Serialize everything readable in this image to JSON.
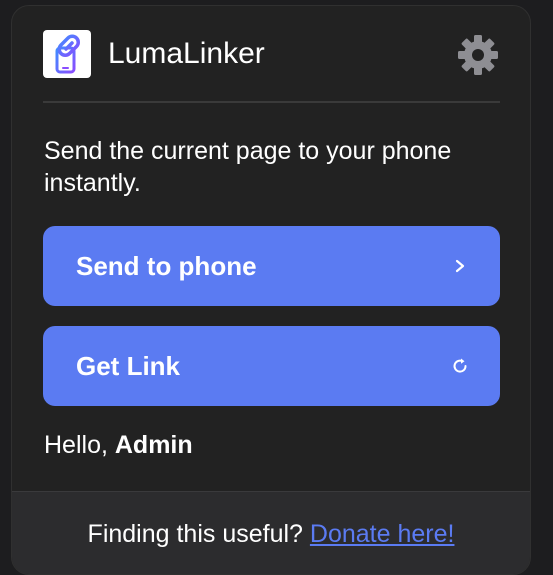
{
  "app": {
    "title": "LumaLinker",
    "logo_icon": "link-phone-icon",
    "settings_icon": "gear-icon"
  },
  "main": {
    "description": "Send the current page to your phone instantly.",
    "buttons": [
      {
        "label": "Send to phone",
        "icon": "chevron-right-icon",
        "glyph": "›"
      },
      {
        "label": "Get Link",
        "icon": "refresh-icon",
        "glyph": "⟳"
      }
    ],
    "greeting": {
      "prefix": "Hello,",
      "user": "Admin"
    }
  },
  "footer": {
    "text": "Finding this useful?",
    "link_label": "Donate here!"
  },
  "colors": {
    "background": "#222222",
    "accent": "#5b7bf2",
    "footer_bg": "#2c2c2e",
    "text": "#ffffff"
  }
}
